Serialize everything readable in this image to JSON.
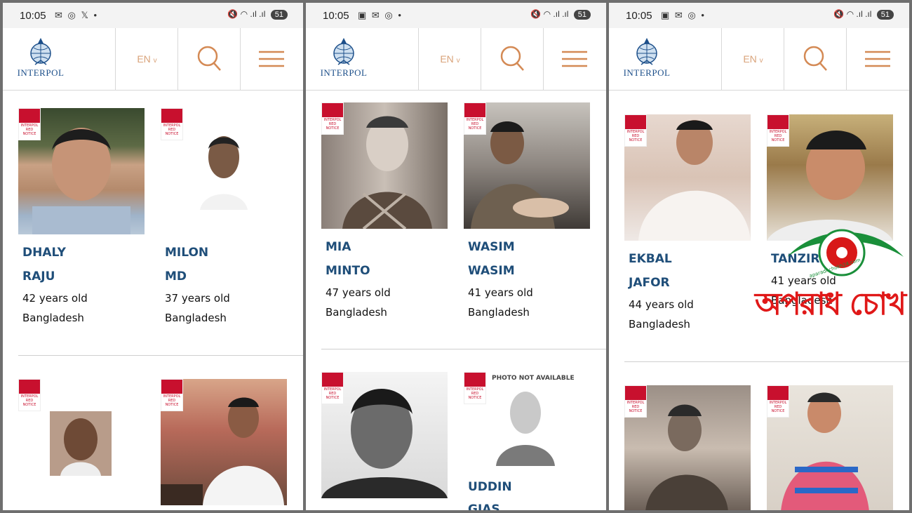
{
  "panels": [
    {
      "status": {
        "time": "10:05",
        "left_icons": "✉ ◎ 𝕏 •",
        "battery": "51"
      },
      "nav": {
        "logo_text": "INTERPOL",
        "lang": "EN"
      },
      "cards": [
        {
          "first": "DHALY",
          "last": "RAJU",
          "age": "42 years old",
          "country": "Bangladesh"
        },
        {
          "first": "MILON",
          "last": "MD",
          "age": "37 years old",
          "country": "Bangladesh"
        }
      ]
    },
    {
      "status": {
        "time": "10:05",
        "left_icons": "▣ ✉ ◎ •",
        "battery": "51"
      },
      "nav": {
        "logo_text": "INTERPOL",
        "lang": "EN"
      },
      "cards": [
        {
          "first": "MIA",
          "last": "MINTO",
          "age": "47 years old",
          "country": "Bangladesh"
        },
        {
          "first": "WASIM",
          "last": "WASIM",
          "age": "41 years old",
          "country": "Bangladesh"
        },
        {
          "first": "UDDIN",
          "last": "GIAS"
        }
      ],
      "photo_not_available": "PHOTO NOT AVAILABLE"
    },
    {
      "status": {
        "time": "10:05",
        "left_icons": "▣ ✉ ◎ •",
        "battery": "51"
      },
      "nav": {
        "logo_text": "INTERPOL",
        "lang": "EN"
      },
      "cards": [
        {
          "first": "EKBAL",
          "last": "JAFOR",
          "age": "44 years old",
          "country": "Bangladesh"
        },
        {
          "first": "TANZIRUL",
          "age": "41 years old",
          "country": "Bangladesh"
        }
      ]
    }
  ],
  "badge": {
    "line1": "INTERPOL",
    "line2": "RED",
    "line3": "NOTICE"
  },
  "watermark": {
    "text": "অপরাধ চোখ",
    "url": "aparadhchokh24.com"
  },
  "colors": {
    "name": "#1f4e79",
    "accent": "#c8102e",
    "nav_icons": "#d48a55"
  }
}
